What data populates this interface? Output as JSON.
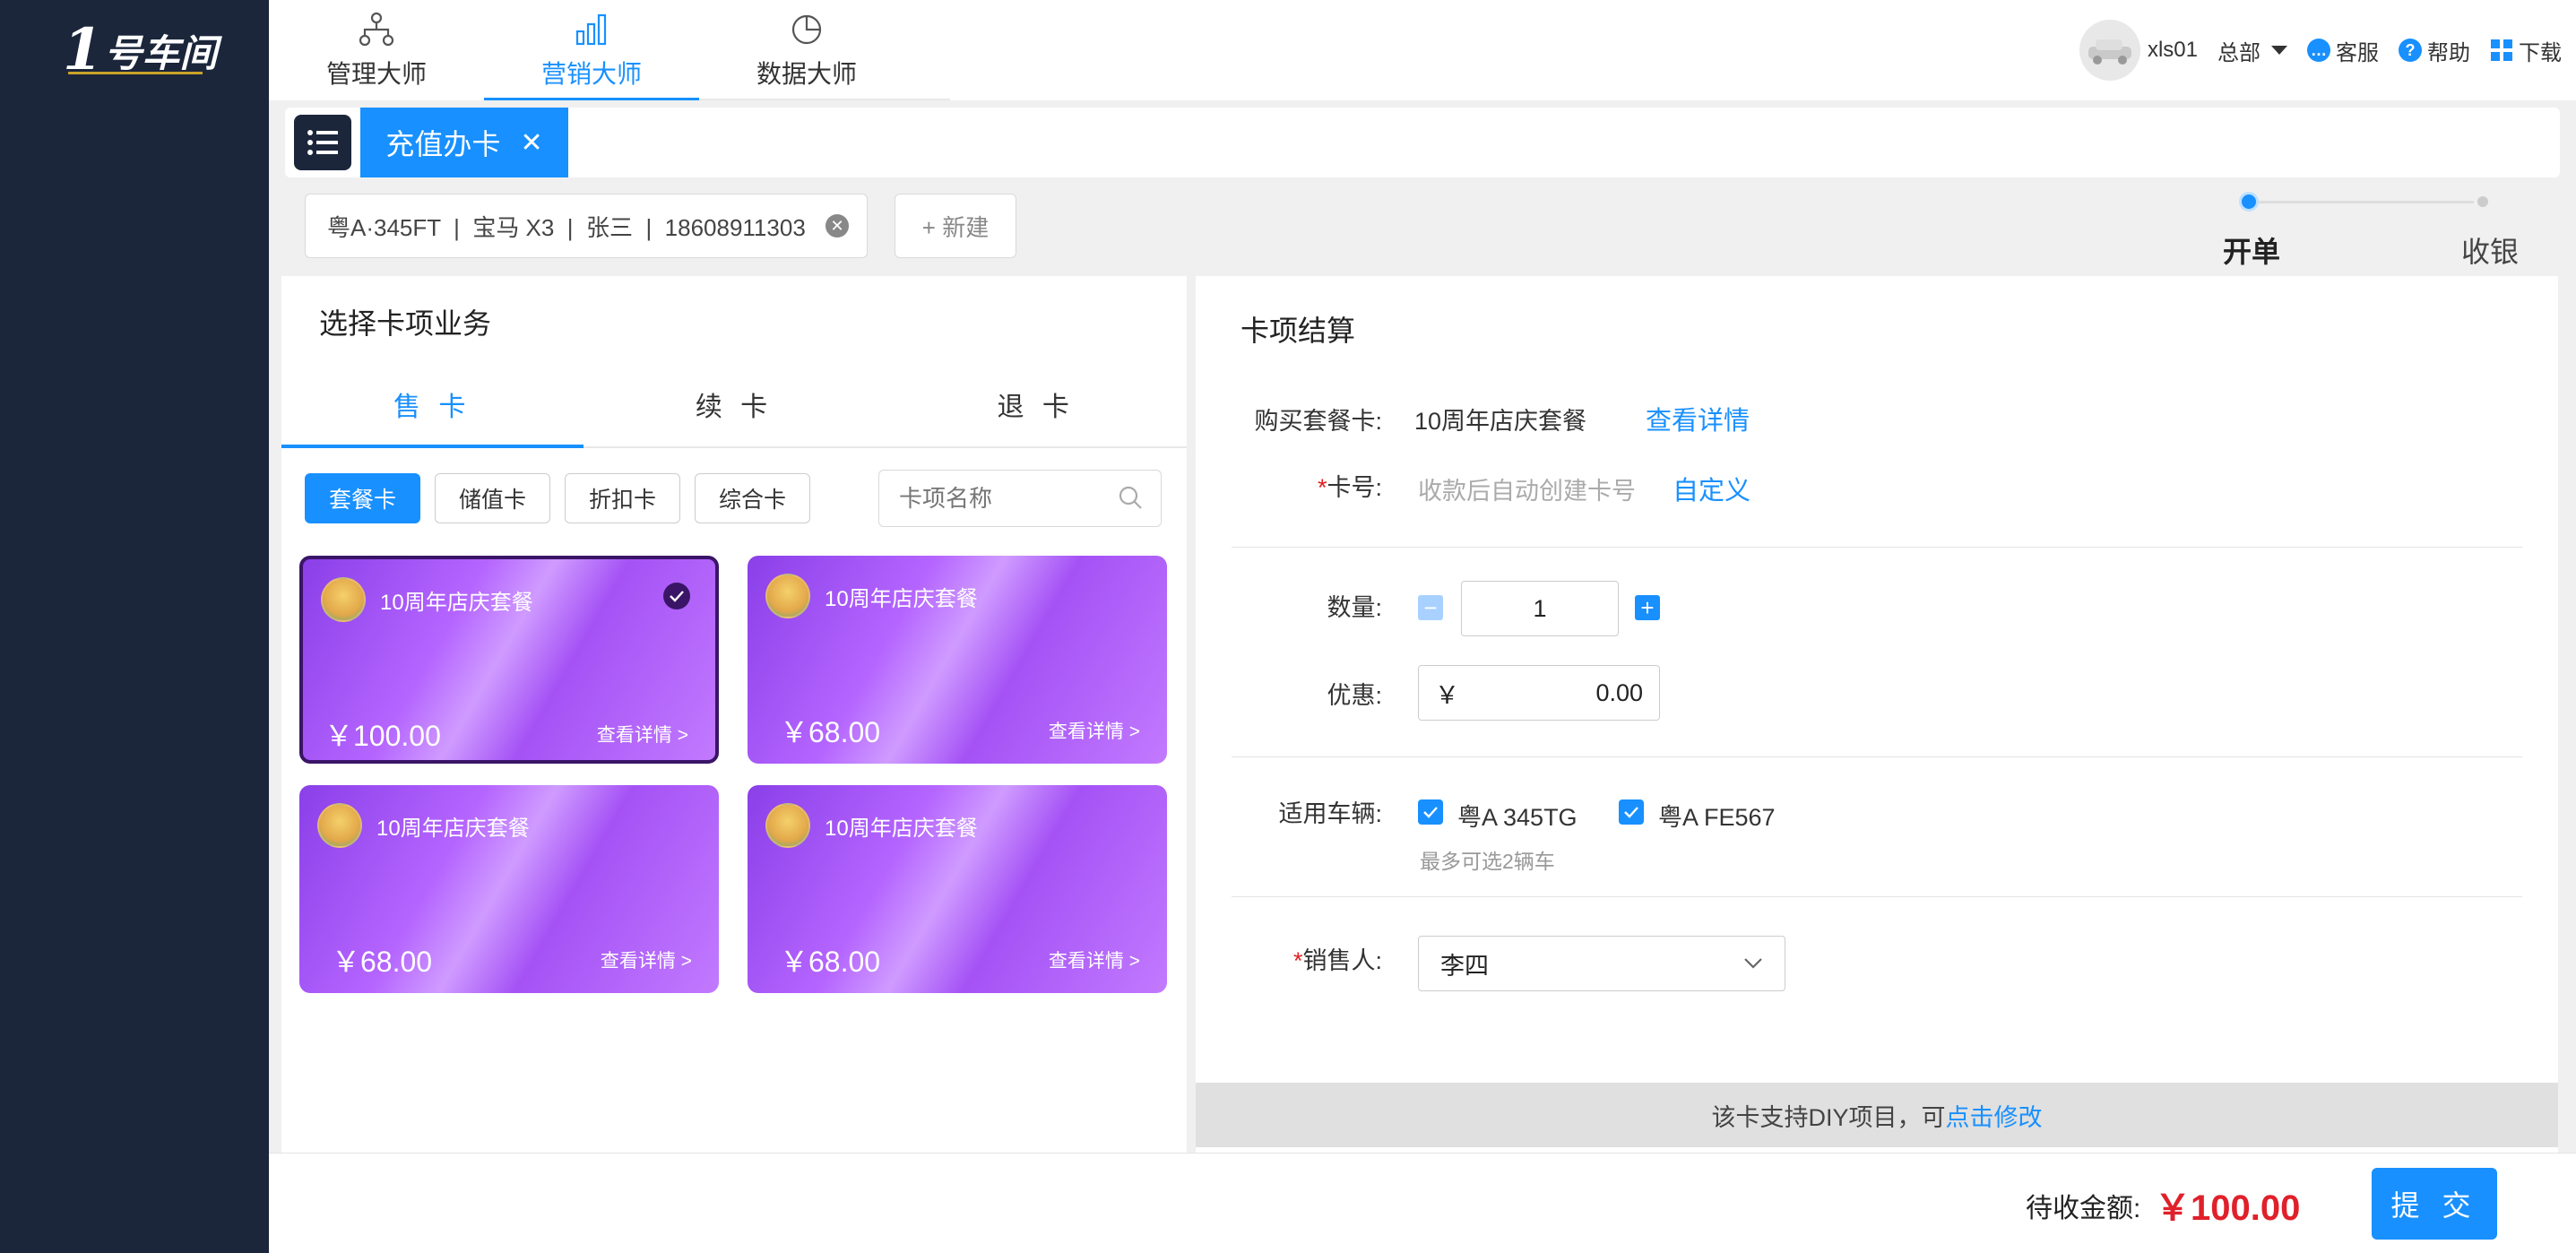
{
  "brand": {
    "logo_num": "1",
    "logo_text": "号车间"
  },
  "topnav": [
    {
      "label": "管理大师",
      "icon": "org-chart-icon"
    },
    {
      "label": "营销大师",
      "icon": "bar-chart-icon"
    },
    {
      "label": "数据大师",
      "icon": "pie-chart-icon"
    }
  ],
  "topnav_active": 1,
  "user": {
    "name": "xls01",
    "branch": "总部",
    "service": "客服",
    "help": "帮助",
    "download": "下载"
  },
  "tabs": {
    "active": "充值办卡"
  },
  "customer": {
    "summary": "粤A·345FT  |  宝马 X3  |  张三  |  18608911303",
    "new_label": "+ 新建"
  },
  "steps": [
    {
      "label": "开单"
    },
    {
      "label": "收银"
    }
  ],
  "left": {
    "title": "选择卡项业务",
    "subtabs": [
      "售 卡",
      "续 卡",
      "退 卡"
    ],
    "filters": [
      "套餐卡",
      "储值卡",
      "折扣卡",
      "综合卡"
    ],
    "search_placeholder": "卡项名称",
    "cards": [
      {
        "title": "10周年店庆套餐",
        "price": "￥100.00",
        "link": "查看详情 >"
      },
      {
        "title": "10周年店庆套餐",
        "price": "￥68.00",
        "link": "查看详情 >"
      },
      {
        "title": "10周年店庆套餐",
        "price": "￥68.00",
        "link": "查看详情 >"
      },
      {
        "title": "10周年店庆套餐",
        "price": "￥68.00",
        "link": "查看详情 >"
      }
    ]
  },
  "right": {
    "title": "卡项结算",
    "buy_label": "购买套餐卡:",
    "buy_value": "10周年店庆套餐",
    "buy_link": "查看详情",
    "card_no_label": "卡号:",
    "card_no_placeholder": "收款后自动创建卡号",
    "card_no_link": "自定义",
    "qty_label": "数量:",
    "qty_value": "1",
    "discount_label": "优惠:",
    "discount_currency": "￥",
    "discount_value": "0.00",
    "vehicle_label": "适用车辆:",
    "vehicles": [
      "粤A 345TG",
      "粤A FE567"
    ],
    "vehicle_hint": "最多可选2辆车",
    "seller_label": "销售人:",
    "seller_value": "李四",
    "diy_text": "该卡支持DIY项目，可",
    "diy_link": "点击修改"
  },
  "footer": {
    "total_label": "待收金额:",
    "total_value": "￥100.00",
    "submit": "提 交"
  },
  "colors": {
    "primary": "#1890ff",
    "sidebar": "#1b263b",
    "price": "#e0202a"
  }
}
